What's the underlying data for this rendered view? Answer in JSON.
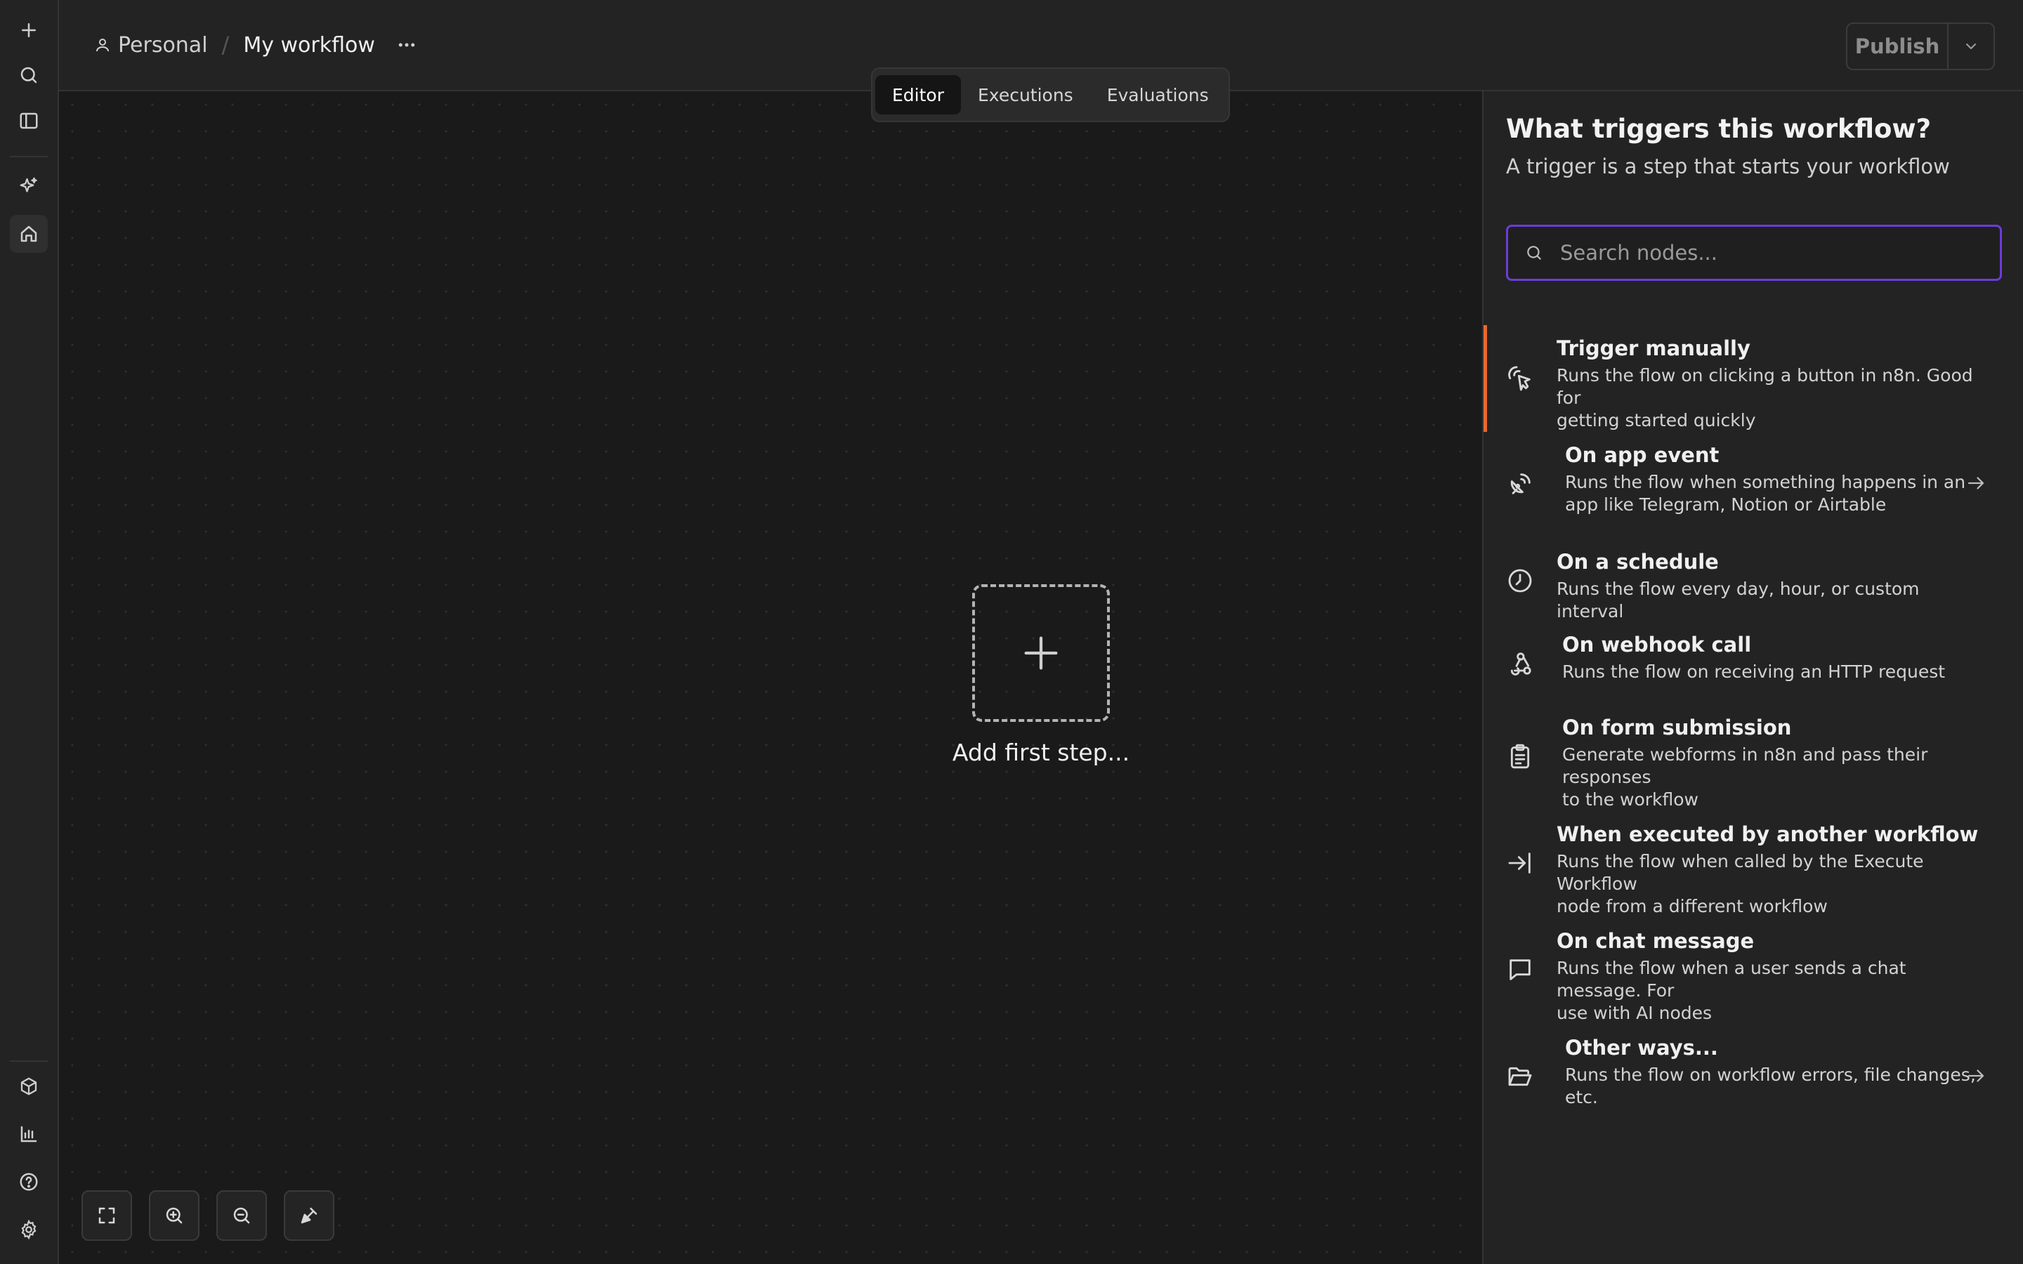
{
  "rail": {
    "top_icons": [
      "plus-icon",
      "search-icon",
      "sidebar-toggle-icon",
      "sparkles-icon",
      "home-icon"
    ],
    "bottom_icons": [
      "templates-icon",
      "insights-icon",
      "help-icon",
      "settings-icon"
    ]
  },
  "header": {
    "project": "Personal",
    "separator": "/",
    "workflow_name": "My workflow",
    "publish_label": "Publish"
  },
  "tabs": [
    {
      "label": "Editor",
      "active": true
    },
    {
      "label": "Executions",
      "active": false
    },
    {
      "label": "Evaluations",
      "active": false
    }
  ],
  "canvas": {
    "add_step_label": "Add first step..."
  },
  "panel": {
    "title": "What triggers this workflow?",
    "subtitle": "A trigger is a step that starts your workflow",
    "search_placeholder": "Search nodes...",
    "triggers": [
      {
        "title": "Trigger manually",
        "desc_lines": [
          "Runs the flow on clicking a button in n8n. Good for",
          "getting started quickly"
        ],
        "icon": "cursor-click-icon",
        "has_arrow": false,
        "active": true
      },
      {
        "title": "On app event",
        "desc_lines": [
          "Runs the flow when something happens in an",
          "app like Telegram, Notion or Airtable"
        ],
        "icon": "satellite-dish-icon",
        "has_arrow": true,
        "active": false
      },
      {
        "title": "On a schedule",
        "desc_lines": [
          "Runs the flow every day, hour, or custom interval"
        ],
        "icon": "clock-icon",
        "has_arrow": false,
        "active": false
      },
      {
        "title": "On webhook call",
        "desc_lines": [
          "Runs the flow on receiving an HTTP request"
        ],
        "icon": "webhook-icon",
        "has_arrow": false,
        "active": false
      },
      {
        "title": "On form submission",
        "desc_lines": [
          "Generate webforms in n8n and pass their responses",
          "to the workflow"
        ],
        "icon": "clipboard-icon",
        "has_arrow": false,
        "active": false
      },
      {
        "title": "When executed by another workflow",
        "desc_lines": [
          "Runs the flow when called by the Execute Workflow",
          "node from a different workflow"
        ],
        "icon": "sign-in-icon",
        "has_arrow": false,
        "active": false
      },
      {
        "title": "On chat message",
        "desc_lines": [
          "Runs the flow when a user sends a chat message. For",
          "use with AI nodes"
        ],
        "icon": "chat-bubble-icon",
        "has_arrow": false,
        "active": false
      },
      {
        "title": "Other ways...",
        "desc_lines": [
          "Runs the flow on workflow errors, file changes,",
          "etc."
        ],
        "icon": "folder-open-icon",
        "has_arrow": true,
        "active": false
      }
    ]
  },
  "colors": {
    "accent_purple": "#6c3cd9",
    "active_trigger_bar": "#e8692c"
  }
}
